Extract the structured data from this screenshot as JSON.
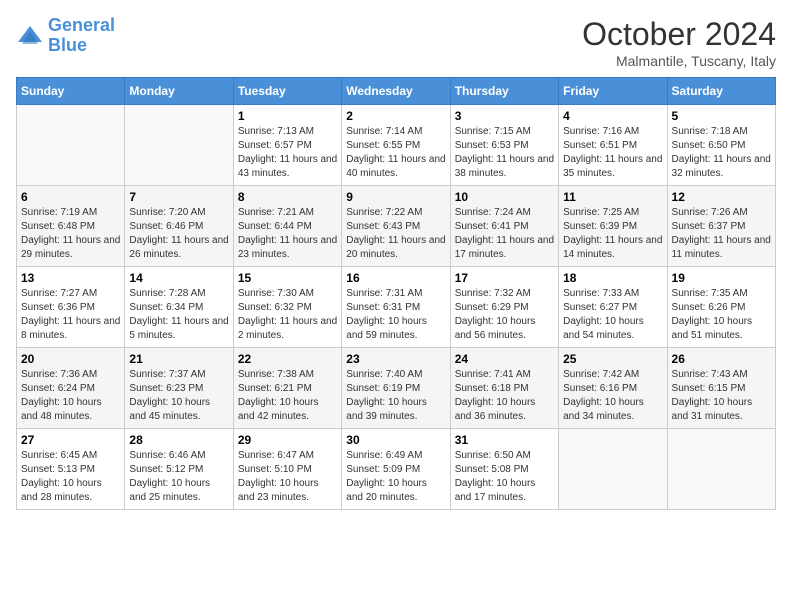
{
  "header": {
    "logo_line1": "General",
    "logo_line2": "Blue",
    "month": "October 2024",
    "location": "Malmantile, Tuscany, Italy"
  },
  "weekdays": [
    "Sunday",
    "Monday",
    "Tuesday",
    "Wednesday",
    "Thursday",
    "Friday",
    "Saturday"
  ],
  "weeks": [
    [
      {
        "day": "",
        "info": ""
      },
      {
        "day": "",
        "info": ""
      },
      {
        "day": "1",
        "info": "Sunrise: 7:13 AM\nSunset: 6:57 PM\nDaylight: 11 hours and 43 minutes."
      },
      {
        "day": "2",
        "info": "Sunrise: 7:14 AM\nSunset: 6:55 PM\nDaylight: 11 hours and 40 minutes."
      },
      {
        "day": "3",
        "info": "Sunrise: 7:15 AM\nSunset: 6:53 PM\nDaylight: 11 hours and 38 minutes."
      },
      {
        "day": "4",
        "info": "Sunrise: 7:16 AM\nSunset: 6:51 PM\nDaylight: 11 hours and 35 minutes."
      },
      {
        "day": "5",
        "info": "Sunrise: 7:18 AM\nSunset: 6:50 PM\nDaylight: 11 hours and 32 minutes."
      }
    ],
    [
      {
        "day": "6",
        "info": "Sunrise: 7:19 AM\nSunset: 6:48 PM\nDaylight: 11 hours and 29 minutes."
      },
      {
        "day": "7",
        "info": "Sunrise: 7:20 AM\nSunset: 6:46 PM\nDaylight: 11 hours and 26 minutes."
      },
      {
        "day": "8",
        "info": "Sunrise: 7:21 AM\nSunset: 6:44 PM\nDaylight: 11 hours and 23 minutes."
      },
      {
        "day": "9",
        "info": "Sunrise: 7:22 AM\nSunset: 6:43 PM\nDaylight: 11 hours and 20 minutes."
      },
      {
        "day": "10",
        "info": "Sunrise: 7:24 AM\nSunset: 6:41 PM\nDaylight: 11 hours and 17 minutes."
      },
      {
        "day": "11",
        "info": "Sunrise: 7:25 AM\nSunset: 6:39 PM\nDaylight: 11 hours and 14 minutes."
      },
      {
        "day": "12",
        "info": "Sunrise: 7:26 AM\nSunset: 6:37 PM\nDaylight: 11 hours and 11 minutes."
      }
    ],
    [
      {
        "day": "13",
        "info": "Sunrise: 7:27 AM\nSunset: 6:36 PM\nDaylight: 11 hours and 8 minutes."
      },
      {
        "day": "14",
        "info": "Sunrise: 7:28 AM\nSunset: 6:34 PM\nDaylight: 11 hours and 5 minutes."
      },
      {
        "day": "15",
        "info": "Sunrise: 7:30 AM\nSunset: 6:32 PM\nDaylight: 11 hours and 2 minutes."
      },
      {
        "day": "16",
        "info": "Sunrise: 7:31 AM\nSunset: 6:31 PM\nDaylight: 10 hours and 59 minutes."
      },
      {
        "day": "17",
        "info": "Sunrise: 7:32 AM\nSunset: 6:29 PM\nDaylight: 10 hours and 56 minutes."
      },
      {
        "day": "18",
        "info": "Sunrise: 7:33 AM\nSunset: 6:27 PM\nDaylight: 10 hours and 54 minutes."
      },
      {
        "day": "19",
        "info": "Sunrise: 7:35 AM\nSunset: 6:26 PM\nDaylight: 10 hours and 51 minutes."
      }
    ],
    [
      {
        "day": "20",
        "info": "Sunrise: 7:36 AM\nSunset: 6:24 PM\nDaylight: 10 hours and 48 minutes."
      },
      {
        "day": "21",
        "info": "Sunrise: 7:37 AM\nSunset: 6:23 PM\nDaylight: 10 hours and 45 minutes."
      },
      {
        "day": "22",
        "info": "Sunrise: 7:38 AM\nSunset: 6:21 PM\nDaylight: 10 hours and 42 minutes."
      },
      {
        "day": "23",
        "info": "Sunrise: 7:40 AM\nSunset: 6:19 PM\nDaylight: 10 hours and 39 minutes."
      },
      {
        "day": "24",
        "info": "Sunrise: 7:41 AM\nSunset: 6:18 PM\nDaylight: 10 hours and 36 minutes."
      },
      {
        "day": "25",
        "info": "Sunrise: 7:42 AM\nSunset: 6:16 PM\nDaylight: 10 hours and 34 minutes."
      },
      {
        "day": "26",
        "info": "Sunrise: 7:43 AM\nSunset: 6:15 PM\nDaylight: 10 hours and 31 minutes."
      }
    ],
    [
      {
        "day": "27",
        "info": "Sunrise: 6:45 AM\nSunset: 5:13 PM\nDaylight: 10 hours and 28 minutes."
      },
      {
        "day": "28",
        "info": "Sunrise: 6:46 AM\nSunset: 5:12 PM\nDaylight: 10 hours and 25 minutes."
      },
      {
        "day": "29",
        "info": "Sunrise: 6:47 AM\nSunset: 5:10 PM\nDaylight: 10 hours and 23 minutes."
      },
      {
        "day": "30",
        "info": "Sunrise: 6:49 AM\nSunset: 5:09 PM\nDaylight: 10 hours and 20 minutes."
      },
      {
        "day": "31",
        "info": "Sunrise: 6:50 AM\nSunset: 5:08 PM\nDaylight: 10 hours and 17 minutes."
      },
      {
        "day": "",
        "info": ""
      },
      {
        "day": "",
        "info": ""
      }
    ]
  ]
}
